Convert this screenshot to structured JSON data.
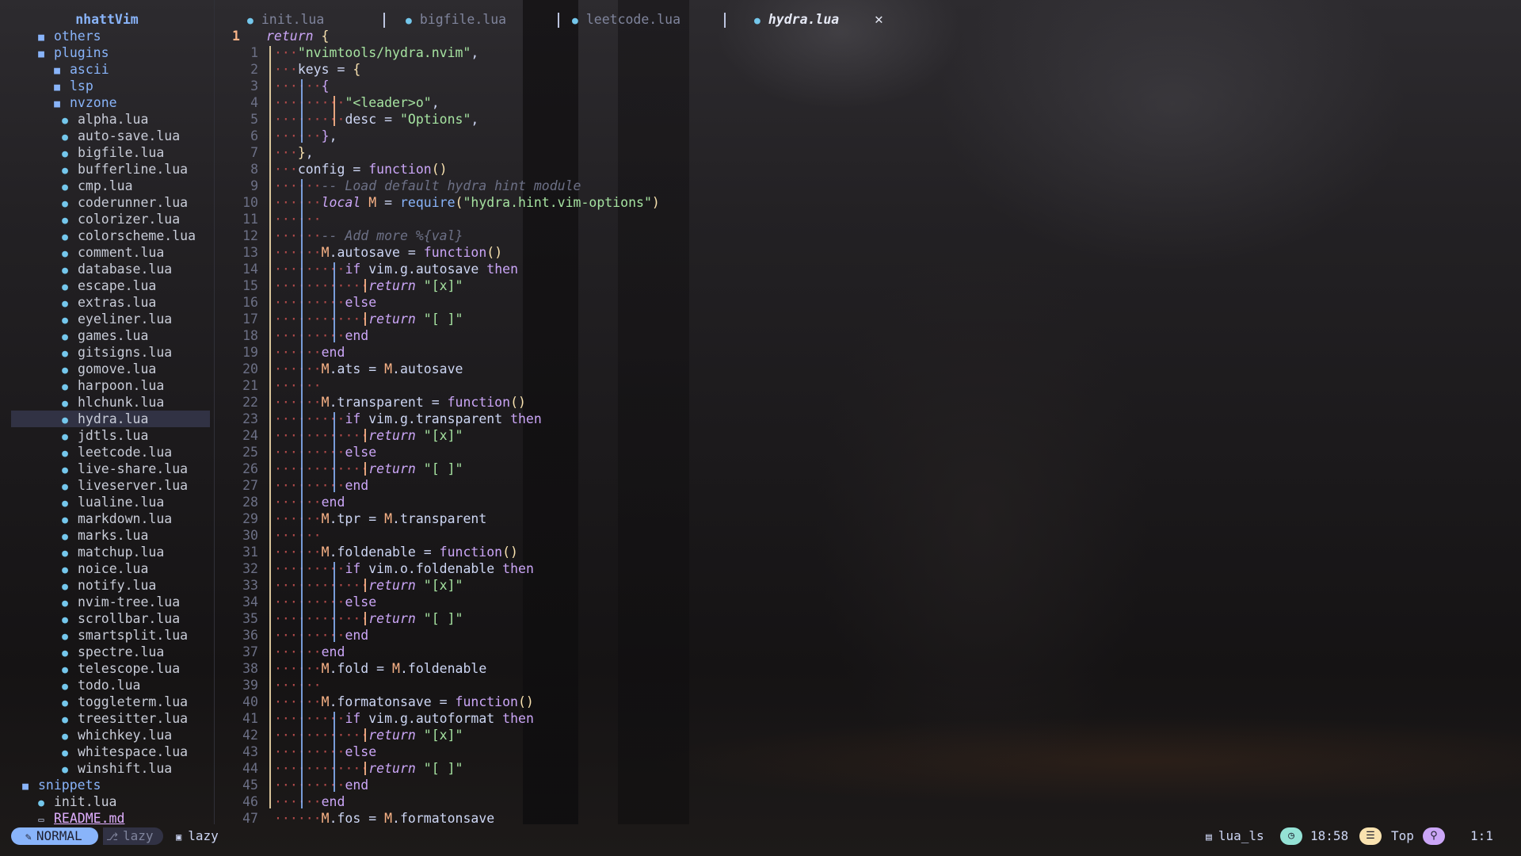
{
  "tree": {
    "title": "nhattVim",
    "items": [
      {
        "label": "others",
        "type": "dir",
        "depth": 1
      },
      {
        "label": "plugins",
        "type": "dir",
        "depth": 1
      },
      {
        "label": "ascii",
        "type": "dir",
        "depth": 2
      },
      {
        "label": "lsp",
        "type": "dir",
        "depth": 2
      },
      {
        "label": "nvzone",
        "type": "dir",
        "depth": 2
      },
      {
        "label": "alpha.lua",
        "type": "file",
        "depth": 3
      },
      {
        "label": "auto-save.lua",
        "type": "file",
        "depth": 3
      },
      {
        "label": "bigfile.lua",
        "type": "file",
        "depth": 3
      },
      {
        "label": "bufferline.lua",
        "type": "file",
        "depth": 3
      },
      {
        "label": "cmp.lua",
        "type": "file",
        "depth": 3
      },
      {
        "label": "coderunner.lua",
        "type": "file",
        "depth": 3
      },
      {
        "label": "colorizer.lua",
        "type": "file",
        "depth": 3
      },
      {
        "label": "colorscheme.lua",
        "type": "file",
        "depth": 3
      },
      {
        "label": "comment.lua",
        "type": "file",
        "depth": 3
      },
      {
        "label": "database.lua",
        "type": "file",
        "depth": 3
      },
      {
        "label": "escape.lua",
        "type": "file",
        "depth": 3
      },
      {
        "label": "extras.lua",
        "type": "file",
        "depth": 3
      },
      {
        "label": "eyeliner.lua",
        "type": "file",
        "depth": 3
      },
      {
        "label": "games.lua",
        "type": "file",
        "depth": 3
      },
      {
        "label": "gitsigns.lua",
        "type": "file",
        "depth": 3
      },
      {
        "label": "gomove.lua",
        "type": "file",
        "depth": 3
      },
      {
        "label": "harpoon.lua",
        "type": "file",
        "depth": 3
      },
      {
        "label": "hlchunk.lua",
        "type": "file",
        "depth": 3
      },
      {
        "label": "hydra.lua",
        "type": "file",
        "depth": 3,
        "selected": true
      },
      {
        "label": "jdtls.lua",
        "type": "file",
        "depth": 3
      },
      {
        "label": "leetcode.lua",
        "type": "file",
        "depth": 3
      },
      {
        "label": "live-share.lua",
        "type": "file",
        "depth": 3
      },
      {
        "label": "liveserver.lua",
        "type": "file",
        "depth": 3
      },
      {
        "label": "lualine.lua",
        "type": "file",
        "depth": 3
      },
      {
        "label": "markdown.lua",
        "type": "file",
        "depth": 3
      },
      {
        "label": "marks.lua",
        "type": "file",
        "depth": 3
      },
      {
        "label": "matchup.lua",
        "type": "file",
        "depth": 3
      },
      {
        "label": "noice.lua",
        "type": "file",
        "depth": 3
      },
      {
        "label": "notify.lua",
        "type": "file",
        "depth": 3
      },
      {
        "label": "nvim-tree.lua",
        "type": "file",
        "depth": 3
      },
      {
        "label": "scrollbar.lua",
        "type": "file",
        "depth": 3
      },
      {
        "label": "smartsplit.lua",
        "type": "file",
        "depth": 3
      },
      {
        "label": "spectre.lua",
        "type": "file",
        "depth": 3
      },
      {
        "label": "telescope.lua",
        "type": "file",
        "depth": 3
      },
      {
        "label": "todo.lua",
        "type": "file",
        "depth": 3
      },
      {
        "label": "toggleterm.lua",
        "type": "file",
        "depth": 3
      },
      {
        "label": "treesitter.lua",
        "type": "file",
        "depth": 3
      },
      {
        "label": "whichkey.lua",
        "type": "file",
        "depth": 3
      },
      {
        "label": "whitespace.lua",
        "type": "file",
        "depth": 3
      },
      {
        "label": "winshift.lua",
        "type": "file",
        "depth": 3
      },
      {
        "label": "snippets",
        "type": "dir",
        "depth": 0
      },
      {
        "label": "init.lua",
        "type": "file",
        "depth": 1
      },
      {
        "label": "README.md",
        "type": "md",
        "depth": 1
      }
    ]
  },
  "tabs": [
    {
      "label": "init.lua",
      "icon": "lua-icon"
    },
    {
      "label": "bigfile.lua",
      "icon": "lua-icon"
    },
    {
      "label": "leetcode.lua",
      "icon": "lua-icon"
    },
    {
      "label": "hydra.lua",
      "icon": "lua-icon",
      "active": true
    }
  ],
  "tab_close_glyph": "✕",
  "editor": {
    "line_numbers": [
      "1",
      "1",
      "2",
      "3",
      "4",
      "5",
      "6",
      "7",
      "8",
      "9",
      "10",
      "11",
      "12",
      "13",
      "14",
      "15",
      "16",
      "17",
      "18",
      "19",
      "20",
      "21",
      "22",
      "23",
      "24",
      "25",
      "26",
      "27",
      "28",
      "29",
      "30",
      "31",
      "32",
      "33",
      "34",
      "35",
      "36",
      "37",
      "38",
      "39",
      "40",
      "41",
      "42",
      "43",
      "44",
      "45",
      "46",
      "47"
    ],
    "lines": [
      [
        [
          "kw",
          "return"
        ],
        [
          "var",
          " "
        ],
        [
          "br1",
          "{"
        ]
      ],
      [
        [
          "ws",
          "···"
        ],
        [
          "str",
          "\"nvimtools/hydra.nvim\""
        ],
        [
          "var",
          ","
        ]
      ],
      [
        [
          "ws",
          "···"
        ],
        [
          "var",
          "keys = "
        ],
        [
          "br1",
          "{"
        ]
      ],
      [
        [
          "ws",
          "···"
        ],
        [
          "ws",
          "···"
        ],
        [
          "br2",
          "{"
        ]
      ],
      [
        [
          "ws",
          "···"
        ],
        [
          "ws",
          "···"
        ],
        [
          "ws",
          "···"
        ],
        [
          "str",
          "\"<leader>o\""
        ],
        [
          "var",
          ","
        ]
      ],
      [
        [
          "ws",
          "···"
        ],
        [
          "ws",
          "···"
        ],
        [
          "ws",
          "···"
        ],
        [
          "var",
          "desc = "
        ],
        [
          "str",
          "\"Options\""
        ],
        [
          "var",
          ","
        ]
      ],
      [
        [
          "ws",
          "···"
        ],
        [
          "ws",
          "···"
        ],
        [
          "br2",
          "}"
        ],
        [
          "var",
          ","
        ]
      ],
      [
        [
          "ws",
          "···"
        ],
        [
          "br1",
          "}"
        ],
        [
          "var",
          ","
        ]
      ],
      [
        [
          "ws",
          "···"
        ],
        [
          "var",
          "config = "
        ],
        [
          "kw2",
          "function"
        ],
        [
          "br1",
          "()"
        ]
      ],
      [
        [
          "ws",
          "···"
        ],
        [
          "ws",
          "···"
        ],
        [
          "cm",
          "-- Load default hydra hint module"
        ]
      ],
      [
        [
          "ws",
          "···"
        ],
        [
          "ws",
          "···"
        ],
        [
          "kw",
          "local"
        ],
        [
          "var",
          " "
        ],
        [
          "mod",
          "M"
        ],
        [
          "var",
          " = "
        ],
        [
          "fn",
          "require"
        ],
        [
          "br1",
          "("
        ],
        [
          "str",
          "\"hydra.hint.vim-options\""
        ],
        [
          "br1",
          ")"
        ]
      ],
      [
        [
          "ws",
          "···"
        ],
        [
          "ws",
          "···"
        ]
      ],
      [
        [
          "ws",
          "···"
        ],
        [
          "ws",
          "···"
        ],
        [
          "cm",
          "-- Add more %{val}"
        ]
      ],
      [
        [
          "ws",
          "···"
        ],
        [
          "ws",
          "···"
        ],
        [
          "mod",
          "M"
        ],
        [
          "var",
          ".autosave = "
        ],
        [
          "kw2",
          "function"
        ],
        [
          "br1",
          "()"
        ]
      ],
      [
        [
          "ws",
          "···"
        ],
        [
          "ws",
          "···"
        ],
        [
          "ws",
          "···"
        ],
        [
          "kw2",
          "if "
        ],
        [
          "var",
          "vim.g.autosave "
        ],
        [
          "kw2",
          "then"
        ]
      ],
      [
        [
          "ws",
          "···"
        ],
        [
          "ws",
          "···"
        ],
        [
          "ws",
          "···"
        ],
        [
          "ws",
          "···"
        ],
        [
          "kw",
          "return"
        ],
        [
          "var",
          " "
        ],
        [
          "str",
          "\"[x]\""
        ]
      ],
      [
        [
          "ws",
          "···"
        ],
        [
          "ws",
          "···"
        ],
        [
          "ws",
          "···"
        ],
        [
          "kw2",
          "else"
        ]
      ],
      [
        [
          "ws",
          "···"
        ],
        [
          "ws",
          "···"
        ],
        [
          "ws",
          "···"
        ],
        [
          "ws",
          "···"
        ],
        [
          "kw",
          "return"
        ],
        [
          "var",
          " "
        ],
        [
          "str",
          "\"[ ]\""
        ]
      ],
      [
        [
          "ws",
          "···"
        ],
        [
          "ws",
          "···"
        ],
        [
          "ws",
          "···"
        ],
        [
          "kw2",
          "end"
        ]
      ],
      [
        [
          "ws",
          "···"
        ],
        [
          "ws",
          "···"
        ],
        [
          "kw2",
          "end"
        ]
      ],
      [
        [
          "ws",
          "···"
        ],
        [
          "ws",
          "···"
        ],
        [
          "mod",
          "M"
        ],
        [
          "var",
          ".ats = "
        ],
        [
          "mod",
          "M"
        ],
        [
          "var",
          ".autosave"
        ]
      ],
      [
        [
          "ws",
          "···"
        ],
        [
          "ws",
          "···"
        ]
      ],
      [
        [
          "ws",
          "···"
        ],
        [
          "ws",
          "···"
        ],
        [
          "mod",
          "M"
        ],
        [
          "var",
          ".transparent = "
        ],
        [
          "kw2",
          "function"
        ],
        [
          "br1",
          "()"
        ]
      ],
      [
        [
          "ws",
          "···"
        ],
        [
          "ws",
          "···"
        ],
        [
          "ws",
          "···"
        ],
        [
          "kw2",
          "if "
        ],
        [
          "var",
          "vim.g.transparent "
        ],
        [
          "kw2",
          "then"
        ]
      ],
      [
        [
          "ws",
          "···"
        ],
        [
          "ws",
          "···"
        ],
        [
          "ws",
          "···"
        ],
        [
          "ws",
          "···"
        ],
        [
          "kw",
          "return"
        ],
        [
          "var",
          " "
        ],
        [
          "str",
          "\"[x]\""
        ]
      ],
      [
        [
          "ws",
          "···"
        ],
        [
          "ws",
          "···"
        ],
        [
          "ws",
          "···"
        ],
        [
          "kw2",
          "else"
        ]
      ],
      [
        [
          "ws",
          "···"
        ],
        [
          "ws",
          "···"
        ],
        [
          "ws",
          "···"
        ],
        [
          "ws",
          "···"
        ],
        [
          "kw",
          "return"
        ],
        [
          "var",
          " "
        ],
        [
          "str",
          "\"[ ]\""
        ]
      ],
      [
        [
          "ws",
          "···"
        ],
        [
          "ws",
          "···"
        ],
        [
          "ws",
          "···"
        ],
        [
          "kw2",
          "end"
        ]
      ],
      [
        [
          "ws",
          "···"
        ],
        [
          "ws",
          "···"
        ],
        [
          "kw2",
          "end"
        ]
      ],
      [
        [
          "ws",
          "···"
        ],
        [
          "ws",
          "···"
        ],
        [
          "mod",
          "M"
        ],
        [
          "var",
          ".tpr = "
        ],
        [
          "mod",
          "M"
        ],
        [
          "var",
          ".transparent"
        ]
      ],
      [
        [
          "ws",
          "···"
        ],
        [
          "ws",
          "···"
        ]
      ],
      [
        [
          "ws",
          "···"
        ],
        [
          "ws",
          "···"
        ],
        [
          "mod",
          "M"
        ],
        [
          "var",
          ".foldenable = "
        ],
        [
          "kw2",
          "function"
        ],
        [
          "br1",
          "()"
        ]
      ],
      [
        [
          "ws",
          "···"
        ],
        [
          "ws",
          "···"
        ],
        [
          "ws",
          "···"
        ],
        [
          "kw2",
          "if "
        ],
        [
          "var",
          "vim.o.foldenable "
        ],
        [
          "kw2",
          "then"
        ]
      ],
      [
        [
          "ws",
          "···"
        ],
        [
          "ws",
          "···"
        ],
        [
          "ws",
          "···"
        ],
        [
          "ws",
          "···"
        ],
        [
          "kw",
          "return"
        ],
        [
          "var",
          " "
        ],
        [
          "str",
          "\"[x]\""
        ]
      ],
      [
        [
          "ws",
          "···"
        ],
        [
          "ws",
          "···"
        ],
        [
          "ws",
          "···"
        ],
        [
          "kw2",
          "else"
        ]
      ],
      [
        [
          "ws",
          "···"
        ],
        [
          "ws",
          "···"
        ],
        [
          "ws",
          "···"
        ],
        [
          "ws",
          "···"
        ],
        [
          "kw",
          "return"
        ],
        [
          "var",
          " "
        ],
        [
          "str",
          "\"[ ]\""
        ]
      ],
      [
        [
          "ws",
          "···"
        ],
        [
          "ws",
          "···"
        ],
        [
          "ws",
          "···"
        ],
        [
          "kw2",
          "end"
        ]
      ],
      [
        [
          "ws",
          "···"
        ],
        [
          "ws",
          "···"
        ],
        [
          "kw2",
          "end"
        ]
      ],
      [
        [
          "ws",
          "···"
        ],
        [
          "ws",
          "···"
        ],
        [
          "mod",
          "M"
        ],
        [
          "var",
          ".fold = "
        ],
        [
          "mod",
          "M"
        ],
        [
          "var",
          ".foldenable"
        ]
      ],
      [
        [
          "ws",
          "···"
        ],
        [
          "ws",
          "···"
        ]
      ],
      [
        [
          "ws",
          "···"
        ],
        [
          "ws",
          "···"
        ],
        [
          "mod",
          "M"
        ],
        [
          "var",
          ".formatonsave = "
        ],
        [
          "kw2",
          "function"
        ],
        [
          "br1",
          "()"
        ]
      ],
      [
        [
          "ws",
          "···"
        ],
        [
          "ws",
          "···"
        ],
        [
          "ws",
          "···"
        ],
        [
          "kw2",
          "if "
        ],
        [
          "var",
          "vim.g.autoformat "
        ],
        [
          "kw2",
          "then"
        ]
      ],
      [
        [
          "ws",
          "···"
        ],
        [
          "ws",
          "···"
        ],
        [
          "ws",
          "···"
        ],
        [
          "ws",
          "···"
        ],
        [
          "kw",
          "return"
        ],
        [
          "var",
          " "
        ],
        [
          "str",
          "\"[x]\""
        ]
      ],
      [
        [
          "ws",
          "···"
        ],
        [
          "ws",
          "···"
        ],
        [
          "ws",
          "···"
        ],
        [
          "kw2",
          "else"
        ]
      ],
      [
        [
          "ws",
          "···"
        ],
        [
          "ws",
          "···"
        ],
        [
          "ws",
          "···"
        ],
        [
          "ws",
          "···"
        ],
        [
          "kw",
          "return"
        ],
        [
          "var",
          " "
        ],
        [
          "str",
          "\"[ ]\""
        ]
      ],
      [
        [
          "ws",
          "···"
        ],
        [
          "ws",
          "···"
        ],
        [
          "ws",
          "···"
        ],
        [
          "kw2",
          "end"
        ]
      ],
      [
        [
          "ws",
          "···"
        ],
        [
          "ws",
          "···"
        ],
        [
          "kw2",
          "end"
        ]
      ],
      [
        [
          "ws",
          "···"
        ],
        [
          "ws",
          "···"
        ],
        [
          "mod",
          "M"
        ],
        [
          "var",
          ".fos = "
        ],
        [
          "mod",
          "M"
        ],
        [
          "var",
          ".formatonsave"
        ]
      ]
    ]
  },
  "statusline": {
    "mode": "NORMAL",
    "branch": "lazy",
    "directory": "lazy",
    "lsp": "lua_ls",
    "time": "18:58",
    "scroll": "Top",
    "cursor": "1:1"
  },
  "colors": {
    "accent": "#89b4fa",
    "string": "#a6e3a1",
    "keyword": "#cba6f7",
    "number_current": "#fab387"
  }
}
